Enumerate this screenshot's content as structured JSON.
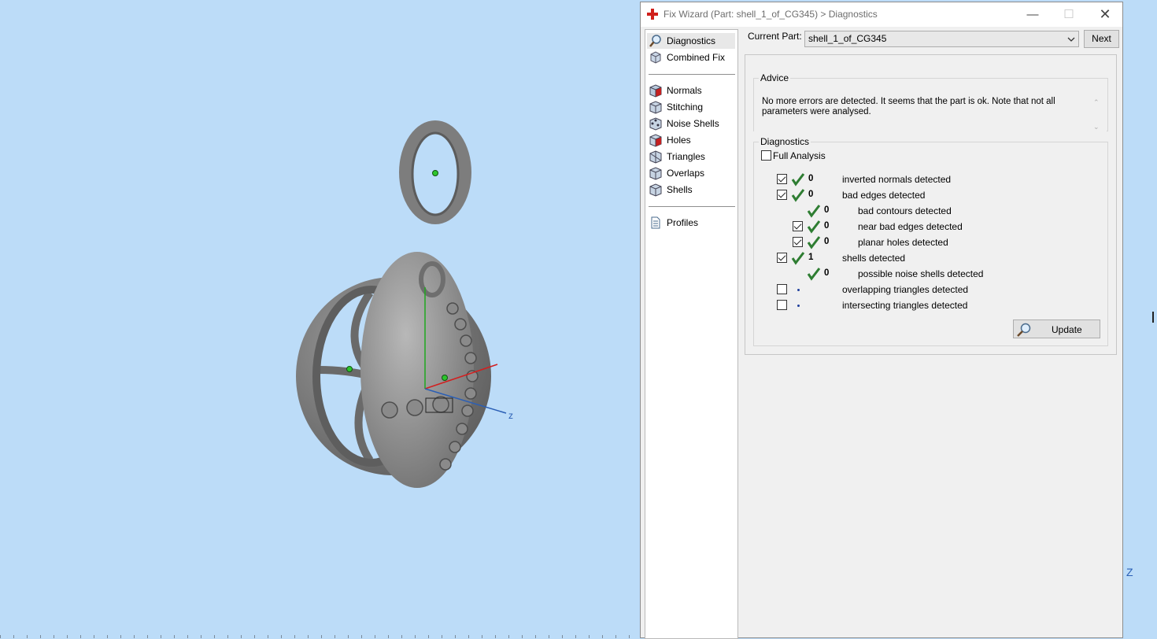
{
  "viewport": {
    "axis_label_z": "z",
    "corner_axis_label": "Z"
  },
  "dialog": {
    "title": "Fix Wizard (Part: shell_1_of_CG345) > Diagnostics",
    "window_buttons": {
      "minimize": "—",
      "maximize": "☐",
      "close": "✕"
    }
  },
  "sidebar": {
    "items": [
      {
        "label": "Diagnostics",
        "icon": "magnifier-icon"
      },
      {
        "label": "Combined Fix",
        "icon": "cube-stack-icon"
      },
      {
        "label": "Normals",
        "icon": "cube-red-face-icon"
      },
      {
        "label": "Stitching",
        "icon": "cube-stitch-icon"
      },
      {
        "label": "Noise Shells",
        "icon": "cube-noise-icon"
      },
      {
        "label": "Holes",
        "icon": "cube-hole-icon"
      },
      {
        "label": "Triangles",
        "icon": "cube-triangle-icon"
      },
      {
        "label": "Overlaps",
        "icon": "cube-overlap-icon"
      },
      {
        "label": "Shells",
        "icon": "cube-shell-icon"
      },
      {
        "label": "Profiles",
        "icon": "document-icon"
      }
    ]
  },
  "main": {
    "current_part_label": "Current Part:",
    "current_part_value": "shell_1_of_CG345",
    "next_label": "Next",
    "advice": {
      "title": "Advice",
      "text": "No more errors are detected. It seems that the part is ok. Note that not all parameters were analysed."
    },
    "diagnostics": {
      "title": "Diagnostics",
      "full_analysis_label": "Full Analysis",
      "full_analysis_checked": false,
      "rows": [
        {
          "checked": true,
          "status": "ok",
          "count": "0",
          "label": "inverted normals detected"
        },
        {
          "checked": true,
          "status": "ok",
          "count": "0",
          "label": "bad edges detected"
        },
        {
          "checked": null,
          "status": "ok",
          "count": "0",
          "label": "bad contours detected"
        },
        {
          "checked": true,
          "status": "ok",
          "count": "0",
          "label": "near bad edges detected"
        },
        {
          "checked": true,
          "status": "ok",
          "count": "0",
          "label": "planar holes detected"
        },
        {
          "checked": true,
          "status": "ok",
          "count": "1",
          "label": "shells detected"
        },
        {
          "checked": null,
          "status": "ok",
          "count": "0",
          "label": "possible noise shells detected"
        },
        {
          "checked": false,
          "status": "pending",
          "count": "",
          "label": "overlapping triangles detected"
        },
        {
          "checked": false,
          "status": "pending",
          "count": "",
          "label": "intersecting triangles detected"
        }
      ]
    },
    "update_label": "Update"
  },
  "colors": {
    "viewport_bg": "#bcdcf8",
    "dialog_bg": "#f0f0f0",
    "ok_check": "#2e7d32",
    "axis_x": "#d21f1f",
    "axis_y": "#1fa81f",
    "axis_z": "#2b5fb5"
  }
}
